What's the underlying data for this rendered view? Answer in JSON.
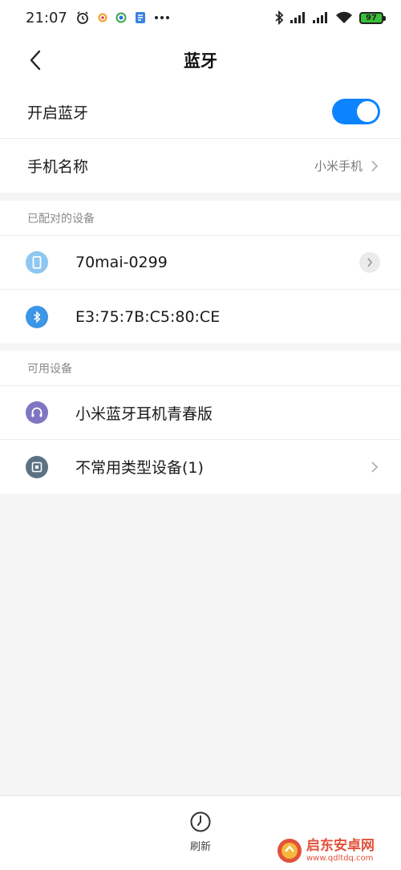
{
  "status_bar": {
    "time": "21:07",
    "battery": "97",
    "icons": [
      "alarm-icon",
      "app-icon",
      "app-icon",
      "app-icon",
      "more-icon",
      "bluetooth-icon",
      "signal-icon",
      "signal-icon",
      "wifi-icon",
      "battery-icon"
    ]
  },
  "header": {
    "title": "蓝牙"
  },
  "settings": {
    "bluetooth_toggle_label": "开启蓝牙",
    "bluetooth_enabled": true,
    "phone_name_label": "手机名称",
    "phone_name_value": "小米手机"
  },
  "paired": {
    "section_title": "已配对的设备",
    "devices": [
      {
        "name": "70mai-0299",
        "icon": "phone-device-icon",
        "color": "#8ec7f0"
      },
      {
        "name": "E3:75:7B:C5:80:CE",
        "icon": "bluetooth-device-icon",
        "color": "#3d95e6"
      }
    ]
  },
  "available": {
    "section_title": "可用设备",
    "devices": [
      {
        "name": "小米蓝牙耳机青春版",
        "icon": "headphones-icon",
        "color": "#7d77c3"
      },
      {
        "name": "不常用类型设备(1)",
        "icon": "generic-device-icon",
        "color": "#5c7283"
      }
    ]
  },
  "bottom_bar": {
    "refresh_label": "刷新"
  },
  "watermark": {
    "title": "启东安卓网",
    "url": "www.qdltdq.com"
  },
  "colors": {
    "accent": "#0d84ff",
    "watermark": "#e2513a"
  }
}
